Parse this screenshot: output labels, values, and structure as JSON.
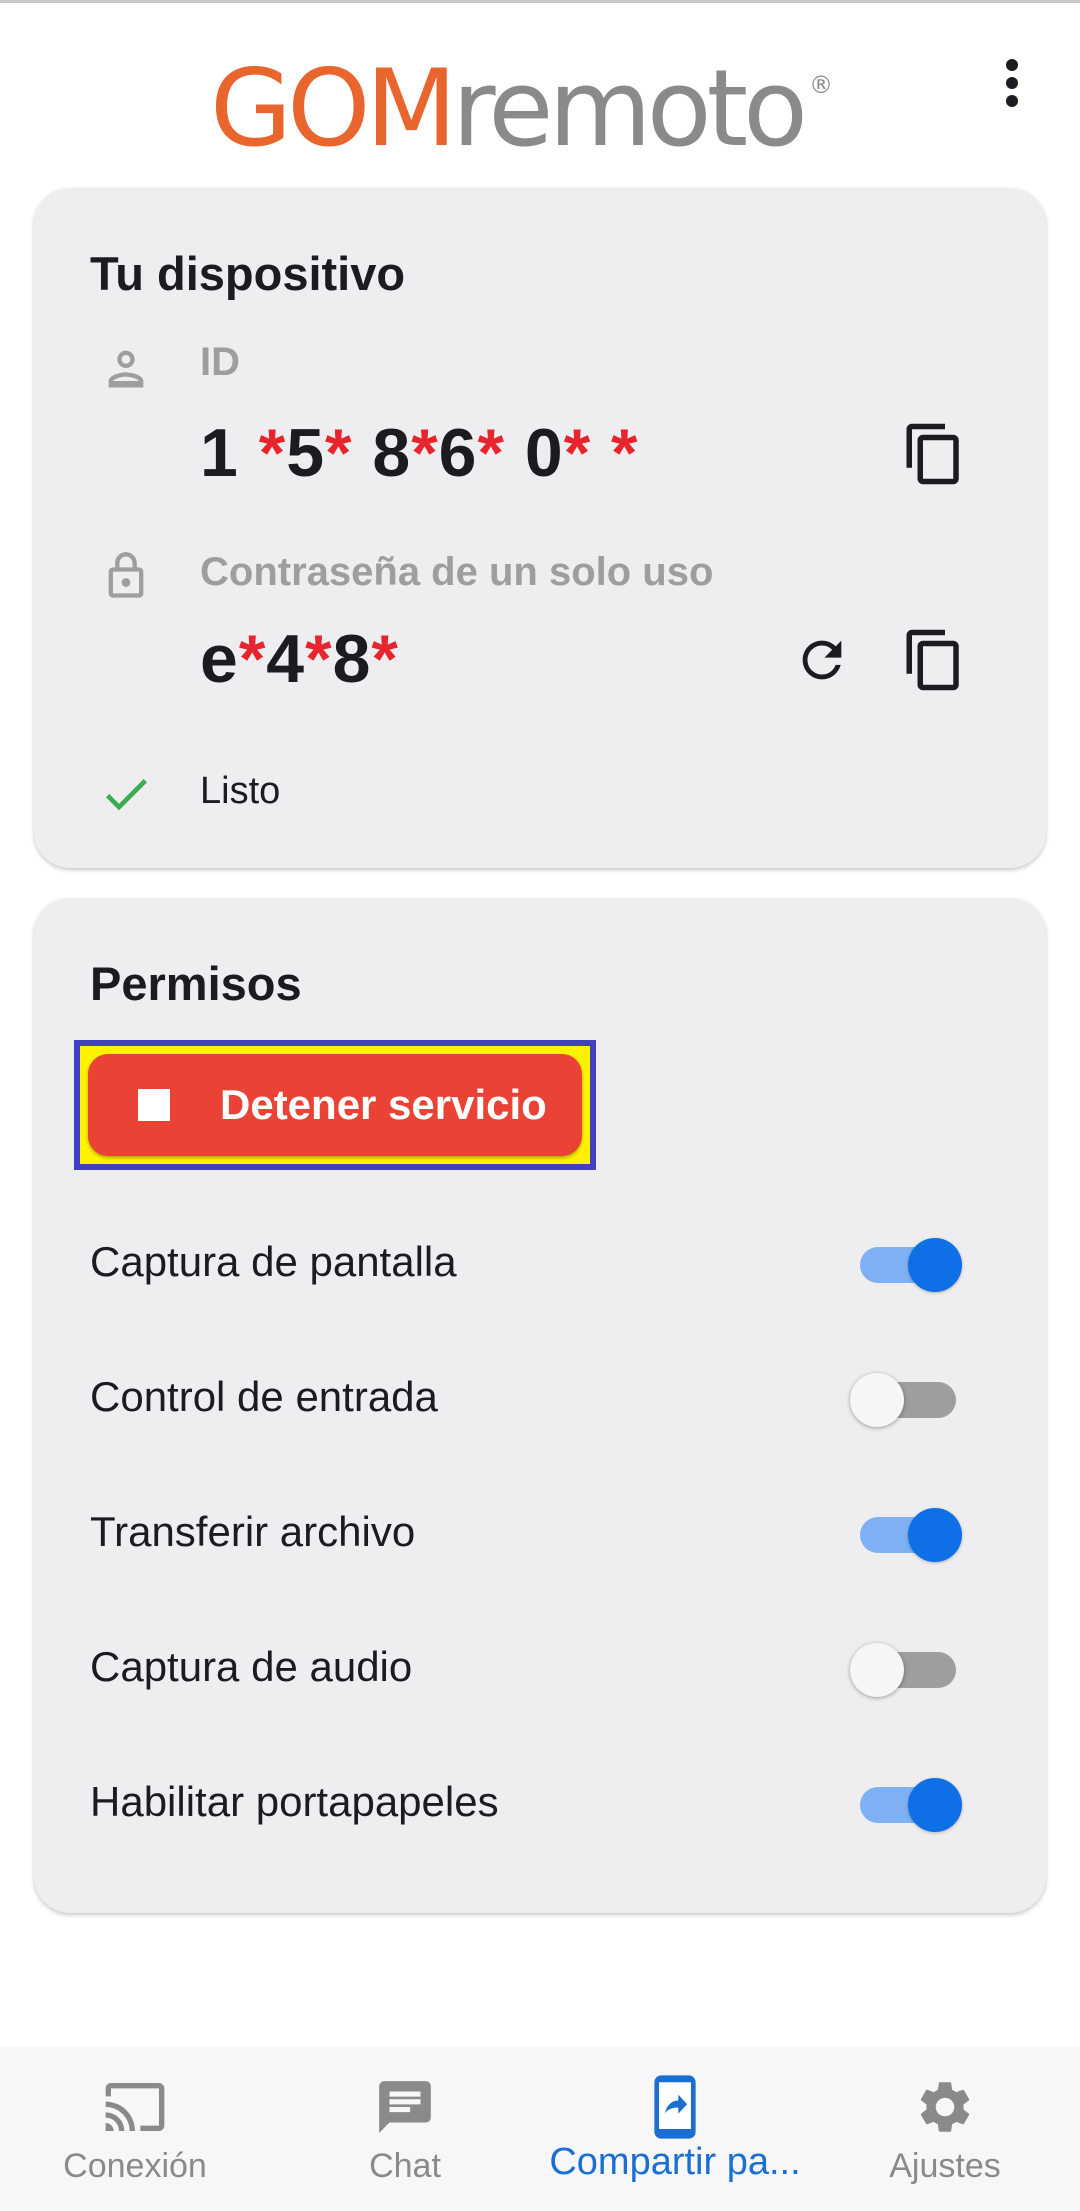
{
  "app": {
    "logo_primary": "GOM",
    "logo_secondary": "remoto",
    "logo_mark": "®",
    "brand_color": "#e8662d",
    "accent_color": "#0f6fe6",
    "danger_color": "#ea4335",
    "mask_color": "#e8242c"
  },
  "device": {
    "title": "Tu dispositivo",
    "id_label": "ID",
    "id_value_parts": [
      {
        "t": "1 ",
        "mask": false
      },
      {
        "t": "*",
        "mask": true
      },
      {
        "t": "5",
        "mask": false
      },
      {
        "t": "*",
        "mask": true
      },
      {
        "t": " 8",
        "mask": false
      },
      {
        "t": "*",
        "mask": true
      },
      {
        "t": "6",
        "mask": false
      },
      {
        "t": "*",
        "mask": true
      },
      {
        "t": " 0",
        "mask": false
      },
      {
        "t": "* *",
        "mask": true
      }
    ],
    "password_label": "Contraseña de un solo uso",
    "password_parts": [
      {
        "t": "e",
        "mask": false
      },
      {
        "t": "*",
        "mask": true
      },
      {
        "t": "4",
        "mask": false
      },
      {
        "t": "*",
        "mask": true
      },
      {
        "t": "8",
        "mask": false
      },
      {
        "t": "*",
        "mask": true
      }
    ],
    "status_text": "Listo",
    "icons": [
      "person-icon",
      "lock-icon",
      "copy-icon",
      "refresh-icon",
      "check-icon"
    ]
  },
  "permissions": {
    "title": "Permisos",
    "stop_button_label": "Detener servicio",
    "items": [
      {
        "label": "Captura de pantalla",
        "enabled": true
      },
      {
        "label": "Control de entrada",
        "enabled": false
      },
      {
        "label": "Transferir archivo",
        "enabled": true
      },
      {
        "label": "Captura de audio",
        "enabled": false
      },
      {
        "label": "Habilitar portapapeles",
        "enabled": true
      }
    ]
  },
  "bottom_nav": {
    "items": [
      {
        "label": "Conexión",
        "icon": "cast-icon",
        "active": false
      },
      {
        "label": "Chat",
        "icon": "chat-icon",
        "active": false
      },
      {
        "label": "Compartir pa...",
        "icon": "share-screen-icon",
        "active": true
      },
      {
        "label": "Ajustes",
        "icon": "gear-icon",
        "active": false
      }
    ]
  }
}
